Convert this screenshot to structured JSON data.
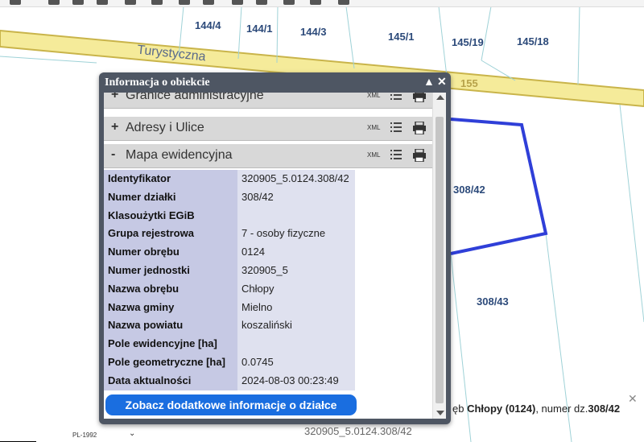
{
  "map": {
    "road_name": "Turystyczna",
    "parcels": [
      "144/4",
      "144/1",
      "144/3",
      "145/1",
      "145/19",
      "145/18",
      "155",
      "308/42",
      "308/43"
    ]
  },
  "popup": {
    "title": "Informacja o obiekcie",
    "sections": [
      {
        "sign": "+",
        "label": "Granice administracyjne",
        "xml": "XML"
      },
      {
        "sign": "+",
        "label": "Adresy i Ulice",
        "xml": "XML"
      },
      {
        "sign": "-",
        "label": "Mapa ewidencyjna",
        "xml": "XML"
      }
    ],
    "rows": [
      {
        "key": "Identyfikator",
        "value": "320905_5.0124.308/42"
      },
      {
        "key": "Numer działki",
        "value": "308/42"
      },
      {
        "key": "Klasoużytki EGiB",
        "value": ""
      },
      {
        "key": "Grupa rejestrowa",
        "value": "7 - osoby fizyczne"
      },
      {
        "key": "Numer obrębu",
        "value": "0124"
      },
      {
        "key": "Numer jednostki",
        "value": "320905_5"
      },
      {
        "key": "Nazwa obrębu",
        "value": "Chłopy"
      },
      {
        "key": "Nazwa gminy",
        "value": "Mielno"
      },
      {
        "key": "Nazwa powiatu",
        "value": "koszaliński"
      },
      {
        "key": "Pole ewidencyjne [ha]",
        "value": ""
      },
      {
        "key": "Pole geometryczne [ha]",
        "value": "0.0745"
      },
      {
        "key": "Data aktualności",
        "value": "2024-08-03 00:23:49"
      }
    ],
    "more_button": "Zobacz dodatkowe informacje o działce"
  },
  "bottom": {
    "info_prefix": "ęb ",
    "info_obreb": "Chłopy (0124)",
    "info_mid": ", numer dz.",
    "info_dz": "308/42",
    "id_text": "320905_5.0124.308/42",
    "projection": "PL-1992"
  },
  "colors": {
    "parcel_highlight": "#2f3fd8",
    "road": "#f5eb9a",
    "popup_frame": "#4e5663",
    "button": "#1a6ee0"
  }
}
